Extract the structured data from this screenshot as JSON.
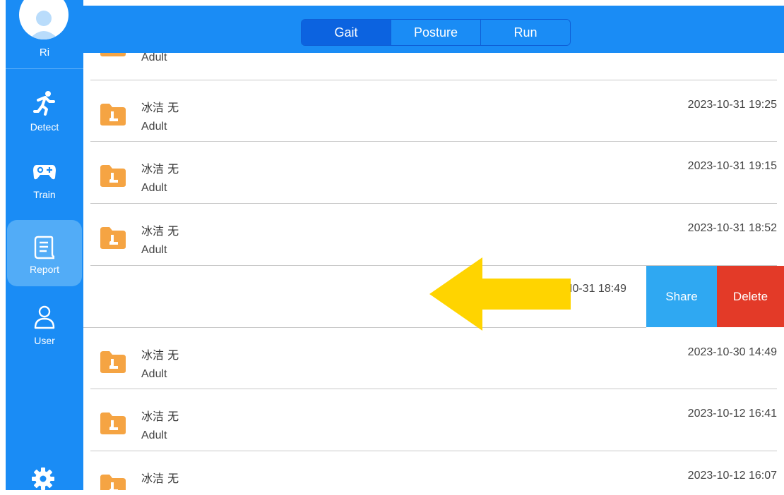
{
  "colors": {
    "primary": "#1a8cf5",
    "active_tab": "#0c63e0",
    "share": "#2fa8f2",
    "delete": "#e33a28",
    "folder": "#f5a443",
    "arrow": "#ffd400"
  },
  "sidebar": {
    "user_name": "Ri",
    "items": [
      {
        "label": "Detect",
        "icon": "running-person-icon"
      },
      {
        "label": "Train",
        "icon": "gamepad-icon"
      },
      {
        "label": "Report",
        "icon": "report-scroll-icon",
        "active": true
      },
      {
        "label": "User",
        "icon": "user-icon"
      }
    ],
    "settings_icon": "gear-icon"
  },
  "tabs": [
    {
      "label": "Gait",
      "active": true
    },
    {
      "label": "Posture"
    },
    {
      "label": "Run"
    }
  ],
  "records": [
    {
      "name": "",
      "type": "Adult",
      "date": ""
    },
    {
      "name": "冰洁 无",
      "type": "Adult",
      "date": "2023-10-31 19:25"
    },
    {
      "name": "冰洁 无",
      "type": "Adult",
      "date": "2023-10-31 19:15"
    },
    {
      "name": "冰洁 无",
      "type": "Adult",
      "date": "2023-10-31 18:52"
    },
    {
      "name": "冰洁 无",
      "type": "Adult",
      "date": "2023-10-30 14:49"
    },
    {
      "name": "冰洁 无",
      "type": "Adult",
      "date": "2023-10-12 16:41"
    },
    {
      "name": "冰洁 无",
      "type": "",
      "date": "2023-10-12 16:07"
    }
  ],
  "swiped_record": {
    "date_partial": "I0-31 18:49",
    "share_label": "Share",
    "delete_label": "Delete"
  }
}
